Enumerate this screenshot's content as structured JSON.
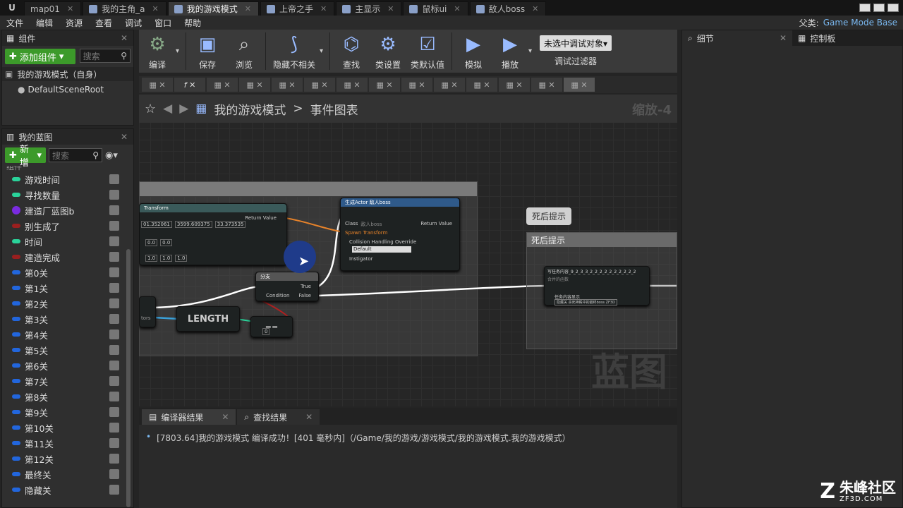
{
  "doc_tabs": [
    {
      "label": "map01",
      "active": false
    },
    {
      "label": "我的主角_a",
      "active": false
    },
    {
      "label": "我的游戏模式",
      "active": true
    },
    {
      "label": "上帝之手",
      "active": false
    },
    {
      "label": "主显示",
      "active": false
    },
    {
      "label": "鼠标ui",
      "active": false
    },
    {
      "label": "敌人boss",
      "active": false
    }
  ],
  "menu": [
    "文件",
    "编辑",
    "资源",
    "查看",
    "调试",
    "窗口",
    "帮助"
  ],
  "parent_class": {
    "label": "父类:",
    "value": "Game Mode Base"
  },
  "components_panel": {
    "title": "组件",
    "add_button": "添加组件",
    "search_placeholder": "搜索",
    "self_item": "我的游戏模式（自身）",
    "root_item": "DefaultSceneRoot"
  },
  "blueprint_panel": {
    "title": "我的蓝图",
    "new_button": "新增",
    "search_placeholder": "搜索",
    "section": "组件",
    "variables": [
      {
        "name": "游戏时间",
        "color": "#2ad39a"
      },
      {
        "name": "寻找数量",
        "color": "#2ad39a"
      },
      {
        "name": "建造厂蓝图b",
        "color": "#7a2be0"
      },
      {
        "name": "别生成了",
        "color": "#9a1f1f"
      },
      {
        "name": "时间",
        "color": "#2ad39a"
      },
      {
        "name": "建造完成",
        "color": "#9a1f1f"
      },
      {
        "name": "第0关",
        "color": "#2266dd"
      },
      {
        "name": "第1关",
        "color": "#2266dd"
      },
      {
        "name": "第2关",
        "color": "#2266dd"
      },
      {
        "name": "第3关",
        "color": "#2266dd"
      },
      {
        "name": "第4关",
        "color": "#2266dd"
      },
      {
        "name": "第5关",
        "color": "#2266dd"
      },
      {
        "name": "第6关",
        "color": "#2266dd"
      },
      {
        "name": "第7关",
        "color": "#2266dd"
      },
      {
        "name": "第8关",
        "color": "#2266dd"
      },
      {
        "name": "第9关",
        "color": "#2266dd"
      },
      {
        "name": "第10关",
        "color": "#2266dd"
      },
      {
        "name": "第11关",
        "color": "#2266dd"
      },
      {
        "name": "第12关",
        "color": "#2266dd"
      },
      {
        "name": "最终关",
        "color": "#2266dd"
      },
      {
        "name": "隐藏关",
        "color": "#2266dd"
      }
    ]
  },
  "toolbar": {
    "compile": "编译",
    "save": "保存",
    "browse": "浏览",
    "hide_unrelated": "隐藏不相关",
    "find": "查找",
    "class_settings": "类设置",
    "class_defaults": "类默认值",
    "simulate": "模拟",
    "play": "播放",
    "debug_target": "未选中调试对象▾",
    "debug_filter": "调试过滤器"
  },
  "graph": {
    "breadcrumb_root": "我的游戏模式",
    "breadcrumb_sep": ">",
    "breadcrumb_leaf": "事件图表",
    "zoom": "缩放-4",
    "watermark": "蓝图",
    "node_transform": {
      "title": "Transform",
      "return": "Return Value",
      "v1": "01.352061",
      "v2": "3599.609375",
      "v3": "33.373535",
      "s1": "0.0",
      "s2": "0.0",
      "s3": "1.0",
      "s4": "1.0",
      "s5": "1.0"
    },
    "node_spawn": {
      "title": "生成Actor 敌人boss",
      "class_label": "Class",
      "class_value": "敌人boss",
      "return": "Return Value",
      "spawn_transform": "Spawn Transform",
      "collision": "Collision Handling Override",
      "collision_value": "Default",
      "instigator": "Instigator"
    },
    "node_branch": {
      "title": "分支",
      "true": "True",
      "false": "False",
      "condition": "Condition"
    },
    "node_length": {
      "title": "LENGTH"
    },
    "node_eq": {
      "title": "==",
      "value": "0"
    },
    "node_task": {
      "title": "写任务内容_9_2_3_3_2_2_2_2_2_2_2_2_2_2",
      "sub": "合并的函数",
      "param_label": "任务内容显示",
      "param_value": "隐藏关 杀死神殿中的最终boss ZF3D"
    },
    "comment_death": "死后提示",
    "bubble_death": "死后提示",
    "left_pin_label": "tors"
  },
  "bottom": {
    "tab_compile": "编译器结果",
    "tab_find": "查找结果",
    "log": "[7803.64]我的游戏模式 编译成功！[401 毫秒内]（/Game/我的游戏/游戏模式/我的游戏模式.我的游戏模式）"
  },
  "right_panels": {
    "details": "细节",
    "palette": "控制板"
  },
  "brand": {
    "name": "朱峰社区",
    "url": "ZF3D.COM"
  }
}
